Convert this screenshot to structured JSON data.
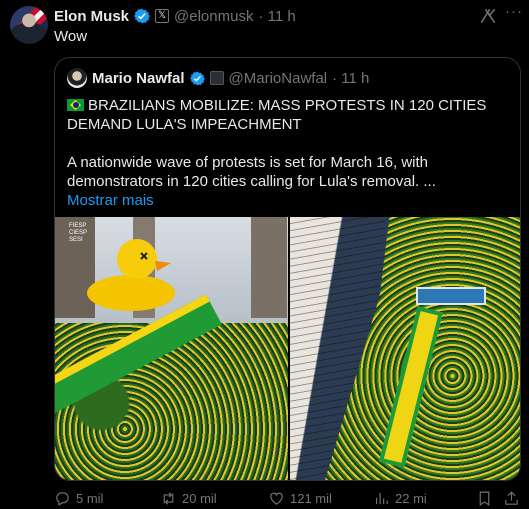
{
  "post": {
    "author_name": "Elon Musk",
    "author_handle": "@elonmusk",
    "time": "· 11 h",
    "text": "Wow"
  },
  "quote": {
    "author_name": "Mario Nawfal",
    "author_handle": "@MarioNawfal",
    "time": "· 11 h",
    "headline": "BRAZILIANS MOBILIZE: MASS PROTESTS IN 120 CITIES DEMAND LULA'S IMPEACHMENT",
    "body": "A nationwide wave of protests is set for March 16, with demonstrators in 120 cities calling for Lula's removal. ...",
    "show_more": "Mostrar mais"
  },
  "photo1_sign": "FIESP\nCIESP\nSESI",
  "actions": {
    "replies": "5 mil",
    "reposts": "20 mil",
    "likes": "121 mil",
    "views": "22 mi"
  },
  "icons": [
    "x-logo-badge-icon",
    "verified-icon",
    "grok-icon",
    "more-icon",
    "reply-icon",
    "repost-icon",
    "like-icon",
    "views-icon",
    "bookmark-icon",
    "share-icon"
  ],
  "colors": {
    "accent": "#1d9bf0",
    "muted": "#71767b",
    "text": "#e7e9ea",
    "border": "#2f3336"
  }
}
